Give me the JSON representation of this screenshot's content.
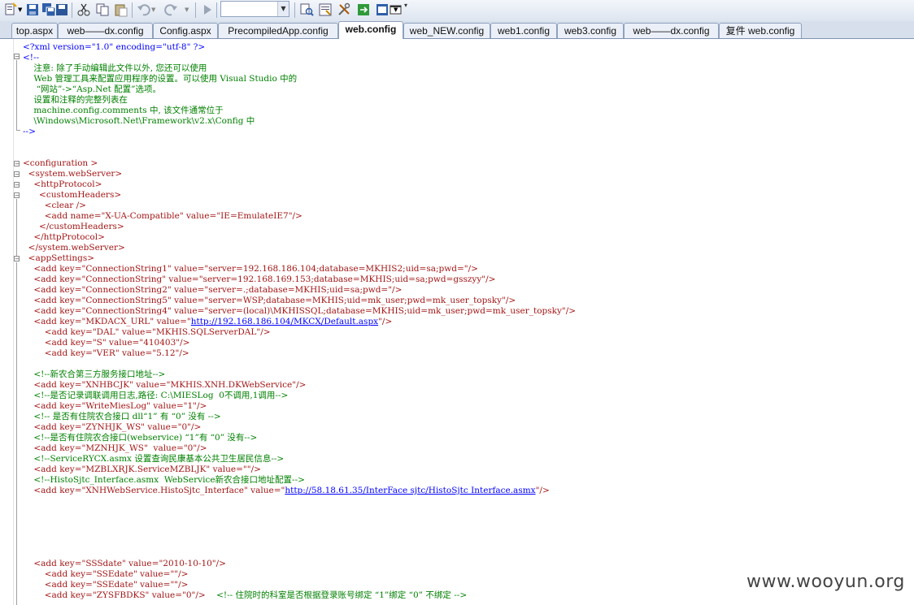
{
  "toolbar": {
    "buttons": [
      "new-item-icon",
      "save-icon",
      "save-all-icon",
      "cut-icon",
      "copy-icon",
      "paste-icon",
      "undo-icon",
      "redo-icon",
      "start-debug-icon",
      "find-in-files-icon",
      "properties-icon",
      "toolbox-icon",
      "solution-explorer-icon",
      "window-icon"
    ],
    "combo_value": ""
  },
  "tabs": [
    {
      "label": "top.aspx",
      "active": false
    },
    {
      "label": "web——dx.config",
      "active": false
    },
    {
      "label": "Config.aspx",
      "active": false
    },
    {
      "label": "PrecompiledApp.config",
      "active": false
    },
    {
      "label": "web.config",
      "active": true
    },
    {
      "label": "web_NEW.config",
      "active": false
    },
    {
      "label": "web1.config",
      "active": false
    },
    {
      "label": "web3.config",
      "active": false
    },
    {
      "label": "web——dx.config",
      "active": false
    },
    {
      "label": "复件 web.config",
      "active": false
    }
  ],
  "code": {
    "l01": "<?xml version=\"1.0\" encoding=\"utf-8\" ?>",
    "l02": "<!--",
    "l03": "    注意: 除了手动编辑此文件以外, 您还可以使用",
    "l04": "    Web 管理工具来配置应用程序的设置。可以使用 Visual Studio 中的",
    "l05": "     “网站”->“Asp.Net 配置”选项。",
    "l06": "    设置和注释的完整列表在",
    "l07": "    machine.config.comments 中, 该文件通常位于",
    "l08": "    \\Windows\\Microsoft.Net\\Framework\\v2.x\\Config 中",
    "l09": "-->",
    "l10": "<configuration >",
    "l11": "  <system.webServer>",
    "l12": "    <httpProtocol>",
    "l13": "      <customHeaders>",
    "l14": "        <clear />",
    "l15a": "        <add name=\"X-UA-Compatible\" value=\"IE=EmulateIE7\"/>",
    "l16": "      </customHeaders>",
    "l17": "    </httpProtocol>",
    "l18": "  </system.webServer>",
    "l19": "  <appSettings>",
    "l20": "    <add key=\"ConnectionString1\" value=\"server=192.168.186.104;database=MKHIS2;uid=sa;pwd=\"/>",
    "l21": "    <add key=\"ConnectionString\" value=\"server=192.168.169.153;database=MKHIS;uid=sa;pwd=gsszyy\"/>",
    "l22": "    <add key=\"ConnectionString2\" value=\"server=.;database=MKHIS;uid=sa;pwd=\"/>",
    "l23": "    <add key=\"ConnectionString5\" value=\"server=WSP;database=MKHIS;uid=mk_user;pwd=mk_user_topsky\"/>",
    "l24": "    <add key=\"ConnectionString4\" value=\"server=(local)\\MKHISSQL;database=MKHIS;uid=mk_user;pwd=mk_user_topsky\"/>",
    "l25_pre": "    <add key=\"MKDACX_URL\" value=\"",
    "l25_url": "http://192.168.186.104/MKCX/Default.aspx",
    "l25_post": "\"/>",
    "l26": "        <add key=\"DAL\" value=\"MKHIS.SQLServerDAL\"/>",
    "l27": "        <add key=\"S\" value=\"410403\"/>",
    "l28": "        <add key=\"VER\" value=\"5.12\"/>",
    "l29": "    <!--新农合第三方服务接口地址-->",
    "l30": "    <add key=\"XNHBCJK\" value=\"MKHIS.XNH.DKWebService\"/>",
    "l31": "    <!--是否记录调联调用日志,路径: C:\\MIESLog  0不调用,1调用-->",
    "l32": "    <add key=\"WriteMiesLog\" value=\"1\"/>",
    "l33": "    <!-- 是否有住院农合接口 dll“1” 有 “0” 没有 -->",
    "l34": "    <add key=\"ZYNHJK_WS\" value=\"0\"/>",
    "l35": "    <!--是否有住院农合接口(webservice) “1”有 “0” 没有-->",
    "l36": "    <add key=\"MZNHJK_WS\"  value=\"0\"/>",
    "l37": "    <!--ServiceRYCX.asmx 设置查询民康基本公共卫生居民信息-->",
    "l38": "    <add key=\"MZBLXRJK.ServiceMZBLJK\" value=\"\"/>",
    "l39": "    <!--HistoSjtc_Interface.asmx  WebService新农合接口地址配置-->",
    "l40_pre": "    <add key=\"XNHWebService.HistoSjtc_Interface\" value=\"",
    "l40_url": "http://58.18.61.35/InterFace sjtc/HistoSjtc Interface.asmx",
    "l40_post": "\"/>",
    "l41": "    <add key=\"SSSdate\" value=\"2010-10-10\"/>",
    "l42": "        <add key=\"SSEdate\" value=\"\"/>",
    "l43": "        <add key=\"SSEdate\" value=\"\"/>",
    "l44": "        <add key=\"ZYSFBDKS\" value=\"0\"/>",
    "l44c": "    <!-- 住院时的科室是否根据登录账号绑定 “1”绑定 “0” 不绑定 -->"
  },
  "watermark": "www.wooyun.org"
}
